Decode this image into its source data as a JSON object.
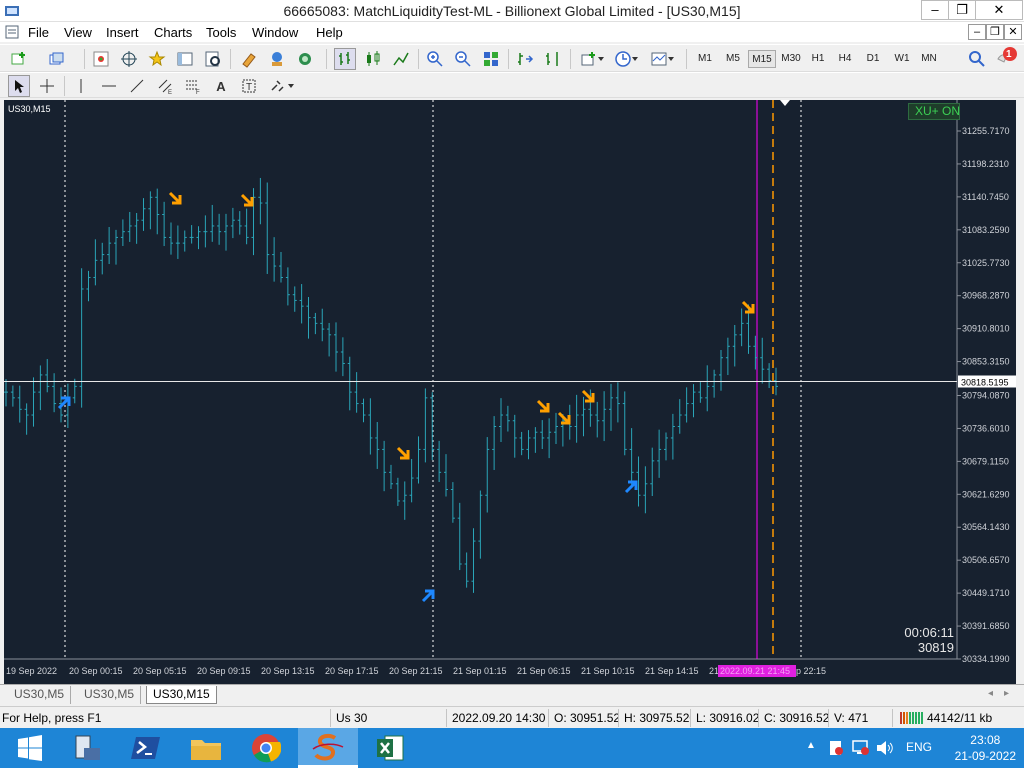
{
  "window": {
    "title": "66665083: MatchLiquidityTest-ML - Billionext Global Limited - [US30,M15]"
  },
  "menu": [
    "File",
    "View",
    "Insert",
    "Charts",
    "Tools",
    "Window",
    "Help"
  ],
  "timeframes": [
    "M1",
    "M5",
    "M15",
    "M30",
    "H1",
    "H4",
    "D1",
    "W1",
    "MN"
  ],
  "active_timeframe": "M15",
  "notification_count": "1",
  "chart": {
    "symbol_label": "US30,M15",
    "indicator_box": "XU+ ON",
    "countdown": "00:06:11",
    "current_price_text": "30819",
    "current_price_label": "30818.5195",
    "highlight_time_label": "2022.09.21 21:45",
    "time_labels_right_tail": "p 22:15"
  },
  "chart_data": {
    "type": "bar",
    "symbol": "US30",
    "timeframe": "M15",
    "y_ticks": [
      "31255.7170",
      "31198.2310",
      "31140.7450",
      "31083.2590",
      "31025.7730",
      "30968.2870",
      "30910.8010",
      "30853.3150",
      "30794.0870",
      "30736.6010",
      "30679.1150",
      "30621.6290",
      "30564.1430",
      "30506.6570",
      "30449.1710",
      "30391.6850",
      "30334.1990"
    ],
    "y_range": [
      30334.199,
      31255.717
    ],
    "x_ticks": [
      "19 Sep 2022",
      "20 Sep 00:15",
      "20 Sep 05:15",
      "20 Sep 09:15",
      "20 Sep 13:15",
      "20 Sep 17:15",
      "20 Sep 21:15",
      "21 Sep 01:15",
      "21 Sep 06:15",
      "21 Sep 10:15",
      "21 Sep 14:15",
      "21"
    ],
    "current_price": 30818.5195,
    "series_close": [
      30800,
      30790,
      30770,
      30760,
      30800,
      30830,
      30810,
      30780,
      30760,
      30790,
      30810,
      30980,
      31000,
      31030,
      31040,
      31060,
      31070,
      31080,
      31090,
      31100,
      31120,
      31140,
      31110,
      31070,
      31060,
      31060,
      31070,
      31070,
      31080,
      31080,
      31090,
      31080,
      31090,
      31100,
      31090,
      31070,
      31140,
      31130,
      31040,
      31020,
      31000,
      30970,
      30960,
      30950,
      30930,
      30920,
      30910,
      30900,
      30870,
      30850,
      30800,
      30780,
      30760,
      30720,
      30700,
      30660,
      30640,
      30610,
      30620,
      30650,
      30700,
      30790,
      30700,
      30660,
      30630,
      30580,
      30500,
      30470,
      30540,
      30620,
      30700,
      30740,
      30760,
      30750,
      30720,
      30700,
      30720,
      30730,
      30720,
      30730,
      30740,
      30750,
      30740,
      30760,
      30770,
      30760,
      30750,
      30770,
      30790,
      30780,
      30700,
      30660,
      30620,
      30640,
      30680,
      30700,
      30720,
      30740,
      30760,
      30780,
      30800,
      30790,
      30810,
      30830,
      30860,
      30880,
      30900,
      30920,
      30880,
      30860,
      30840,
      30820,
      30810
    ],
    "sell_arrows": [
      {
        "time": "20 Sep 05:15",
        "price": 31140
      },
      {
        "time": "20 Sep 09:15",
        "price": 31140
      },
      {
        "time": "20 Sep 21:15",
        "price": 30680
      },
      {
        "time": "21 Sep 06:15",
        "price": 30760
      },
      {
        "time": "21 Sep 06:15",
        "price": 30735
      },
      {
        "time": "21 Sep 10:15",
        "price": 30785
      },
      {
        "time": "21 Sep 18:15",
        "price": 30950
      }
    ],
    "buy_arrows": [
      {
        "time": "20 Sep 00:15",
        "price": 30790
      },
      {
        "time": "20 Sep 21:15",
        "price": 30450
      },
      {
        "time": "21 Sep 10:15",
        "price": 30620
      }
    ]
  },
  "tabs": [
    "US30,M5",
    "US30,M5",
    "US30,M15"
  ],
  "active_tab": 2,
  "status": {
    "help": "For Help, press F1",
    "profile": "Us 30",
    "datetime": "2022.09.20 14:30",
    "open": "O: 30951.520",
    "high": "H: 30975.520",
    "low": "L: 30916.020",
    "close": "C: 30916.520",
    "volume": "V: 471",
    "traffic": "44142/11 kb"
  },
  "taskbar": {
    "lang": "ENG",
    "time": "23:08",
    "date": "21-09-2022"
  },
  "colors": {
    "chart_bg": "#17212f",
    "bars": "#2aa5b8",
    "sell_arrow": "#ffa000",
    "buy_arrow": "#1e88ff",
    "period_line": "#ff00ff",
    "future_line": "#ff9900"
  }
}
